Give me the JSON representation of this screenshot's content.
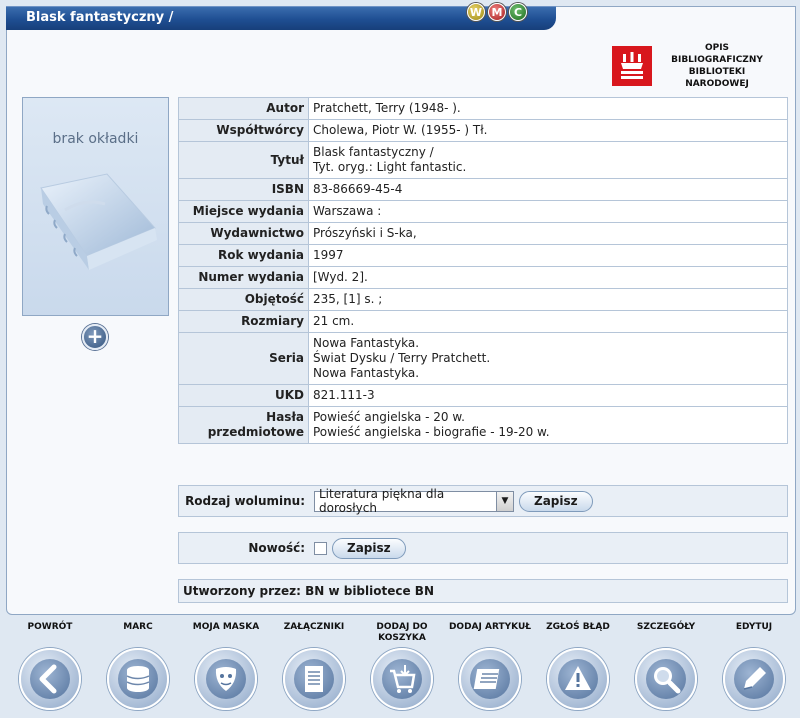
{
  "window": {
    "title": "Blask fantastyczny /",
    "buttons": [
      "W",
      "M",
      "C"
    ]
  },
  "logo": {
    "lines": [
      "OPIS BIBLIOGRAFICZNY",
      "BIBLIOTEKI",
      "NARODOWEJ"
    ],
    "color": "#d8171d"
  },
  "cover": {
    "text": "brak okładki"
  },
  "record": [
    {
      "label": "Autor",
      "lines": [
        "Pratchett, Terry (1948- )."
      ]
    },
    {
      "label": "Współtwórcy",
      "lines": [
        "Cholewa, Piotr W. (1955- ) Tł."
      ]
    },
    {
      "label": "Tytuł",
      "lines": [
        "Blask fantastyczny /",
        "Tyt. oryg.: Light fantastic."
      ]
    },
    {
      "label": "ISBN",
      "lines": [
        "83-86669-45-4"
      ]
    },
    {
      "label": "Miejsce wydania",
      "lines": [
        "Warszawa :"
      ]
    },
    {
      "label": "Wydawnictwo",
      "lines": [
        "Prószyński i S-ka,"
      ]
    },
    {
      "label": "Rok wydania",
      "lines": [
        "1997"
      ]
    },
    {
      "label": "Numer wydania",
      "lines": [
        "[Wyd. 2]."
      ]
    },
    {
      "label": "Objętość",
      "lines": [
        "235, [1] s. ;"
      ]
    },
    {
      "label": "Rozmiary",
      "lines": [
        "21 cm."
      ]
    },
    {
      "label": "Seria",
      "lines": [
        "Nowa Fantastyka.",
        "Świat Dysku / Terry Pratchett.",
        "Nowa Fantastyka."
      ]
    },
    {
      "label": "UKD",
      "lines": [
        "821.111-3"
      ]
    },
    {
      "label": "Hasła przedmiotowe",
      "lines": [
        "Powieść angielska - 20 w.",
        "Powieść angielska - biografie - 19-20 w."
      ]
    }
  ],
  "volume": {
    "label": "Rodzaj woluminu:",
    "selected": "Literatura piękna dla dorosłych",
    "save": "Zapisz"
  },
  "novelty": {
    "label": "Nowość:",
    "save": "Zapisz"
  },
  "created_by": "Utworzony przez: BN w bibliotece BN",
  "toolbar": [
    {
      "id": "powrot",
      "label": "POWRÓT",
      "icon": "back-arrow-icon"
    },
    {
      "id": "marc",
      "label": "MARC",
      "icon": "database-icon"
    },
    {
      "id": "moja-maska",
      "label": "MOJA MASKA",
      "icon": "mask-icon"
    },
    {
      "id": "zalaczniki",
      "label": "ZAŁĄCZNIKI",
      "icon": "document-icon"
    },
    {
      "id": "dodaj-koszyk",
      "label": "DODAJ DO KOSZYKA",
      "icon": "cart-icon"
    },
    {
      "id": "dodaj-artykul",
      "label": "DODAJ ARTYKUŁ",
      "icon": "article-icon"
    },
    {
      "id": "zglos-blad",
      "label": "ZGŁOŚ BŁĄD",
      "icon": "warning-icon"
    },
    {
      "id": "szczegoly",
      "label": "SZCZEGÓŁY",
      "icon": "magnifier-icon"
    },
    {
      "id": "edytuj",
      "label": "EDYTUJ",
      "icon": "edit-icon"
    }
  ]
}
